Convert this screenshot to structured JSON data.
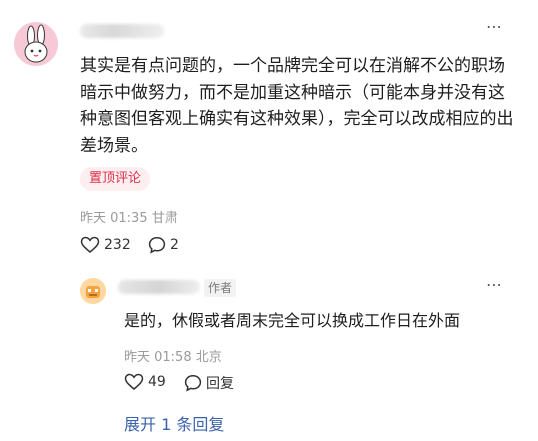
{
  "comment": {
    "text": "其实是有点问题的，一个品牌完全可以在消解不公的职场暗示中做努力，而不是加重这种暗示（可能本身并没有这种意图但客观上确实有这种效果），完全可以改成相应的出差场景。",
    "pinned_label": "置顶评论",
    "time": "昨天 01:35",
    "location": "甘肃",
    "likes": "232",
    "replies": "2",
    "more_icon": "⋯",
    "accent_color": "#e0304c"
  },
  "reply": {
    "author_tag": "作者",
    "text": "是的，休假或者周末完全可以换成工作日在外面",
    "time": "昨天 01:58",
    "location": "北京",
    "likes": "49",
    "reply_label": "回复",
    "more_icon": "⋯"
  },
  "expand": {
    "label": "展开 1 条回复",
    "link_color": "#3b63ad"
  }
}
